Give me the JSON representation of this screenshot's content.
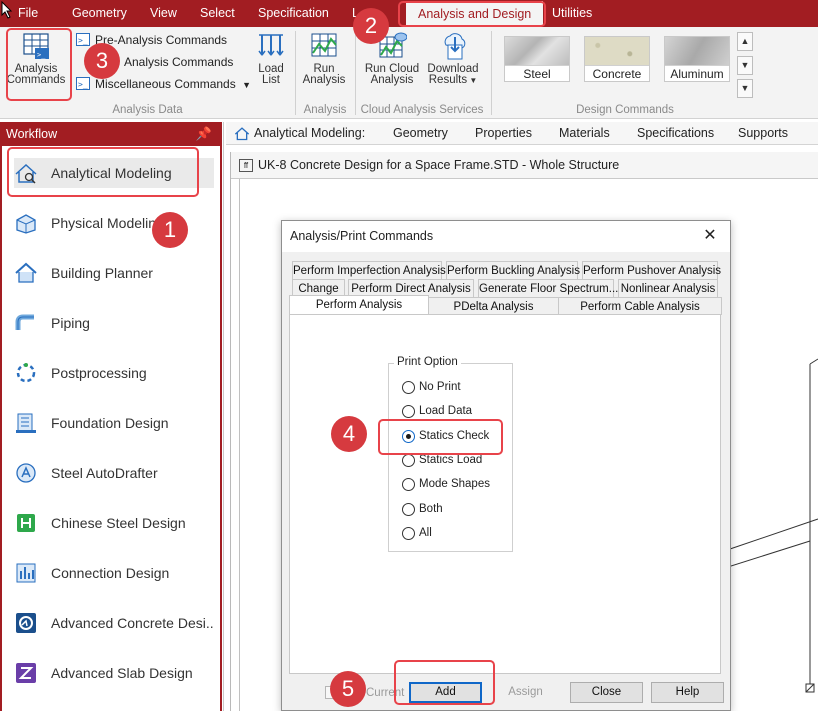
{
  "menu": {
    "items": [
      "File",
      "Geometry",
      "View",
      "Select",
      "Specification",
      "L",
      "Analysis and Design",
      "Utilities"
    ],
    "active": "Analysis and Design"
  },
  "ribbon": {
    "analysis_commands": "Analysis\nCommands",
    "analysis_commands_l1": "Analysis",
    "analysis_commands_l2": "Commands",
    "pre_analysis": "Pre-Analysis Commands",
    "post_analysis": "Analysis Commands",
    "misc_analysis": "Miscellaneous Commands",
    "load_list_l1": "Load",
    "load_list_l2": "List",
    "group_analysis_data": "Analysis Data",
    "run_analysis_l1": "Run",
    "run_analysis_l2": "Analysis",
    "group_analysis": "Analysis",
    "run_cloud_l1": "Run Cloud",
    "run_cloud_l2": "Analysis",
    "download_l1": "Download",
    "download_l2": "Results",
    "group_cloud": "Cloud Analysis Services",
    "materials": [
      "Steel",
      "Concrete",
      "Aluminum"
    ],
    "group_design": "Design Commands"
  },
  "workflow": {
    "header": "Workflow",
    "items": [
      "Analytical Modeling",
      "Physical Modeling",
      "Building Planner",
      "Piping",
      "Postprocessing",
      "Foundation Design",
      "Steel AutoDrafter",
      "Chinese Steel Design",
      "Connection Design",
      "Advanced Concrete Desi...",
      "Advanced Slab Design"
    ]
  },
  "tabstrip": {
    "context": "Analytical Modeling:",
    "items": [
      "Geometry",
      "Properties",
      "Materials",
      "Specifications",
      "Supports"
    ]
  },
  "document": {
    "title": "UK-8 Concrete Design for a Space Frame.STD - Whole Structure"
  },
  "dialog": {
    "title": "Analysis/Print Commands",
    "tabs_row1": [
      "Perform Imperfection Analysis",
      "Perform Buckling Analysis",
      "Perform Pushover Analysis"
    ],
    "tabs_row2": [
      "Change",
      "Perform Direct Analysis",
      "Generate Floor Spectrum...",
      "Nonlinear Analysis"
    ],
    "tabs_row3": [
      "Perform Analysis",
      "PDelta Analysis",
      "Perform Cable Analysis"
    ],
    "active_tab": "Perform Analysis",
    "group_label": "Print Option",
    "options": [
      "No Print",
      "Load Data",
      "Statics Check",
      "Statics Load",
      "Mode Shapes",
      "Both",
      "All"
    ],
    "selected_option": "Statics Check",
    "current_label": "Current",
    "buttons": {
      "add": "Add",
      "assign": "Assign",
      "close": "Close",
      "help": "Help"
    }
  },
  "callouts": [
    "1",
    "2",
    "3",
    "4",
    "5"
  ],
  "colors": {
    "brand": "#a21d22",
    "callout": "#d63a3f",
    "highlight": "#e8434a"
  }
}
